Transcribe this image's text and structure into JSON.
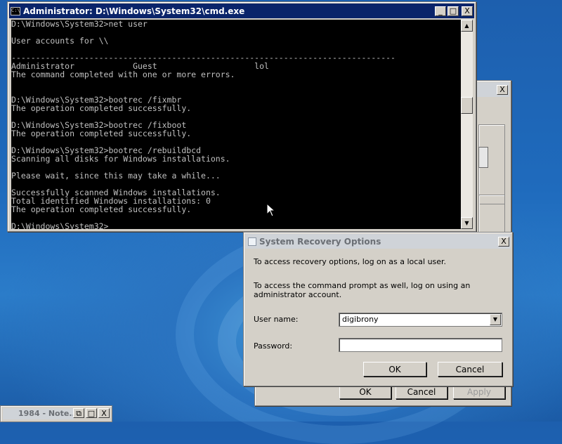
{
  "cmd_window": {
    "title": "Administrator: D:\\Windows\\System32\\cmd.exe",
    "icon_text": "C:\\",
    "lines": [
      "D:\\Windows\\System32>net user",
      "",
      "User accounts for \\\\",
      "",
      "-------------------------------------------------------------------------------",
      "Administrator            Guest                    lol",
      "The command completed with one or more errors.",
      "",
      "",
      "D:\\Windows\\System32>bootrec /fixmbr",
      "The operation completed successfully.",
      "",
      "D:\\Windows\\System32>bootrec /fixboot",
      "The operation completed successfully.",
      "",
      "D:\\Windows\\System32>bootrec /rebuildbcd",
      "Scanning all disks for Windows installations.",
      "",
      "Please wait, since this may take a while...",
      "",
      "Successfully scanned Windows installations.",
      "Total identified Windows installations: 0",
      "The operation completed successfully.",
      "",
      "D:\\Windows\\System32>"
    ],
    "minimize_glyph": "_",
    "maximize_glyph": "□",
    "close_glyph": "X"
  },
  "background_window": {
    "close_glyph": "X",
    "ok_label": "OK",
    "cancel_label": "Cancel",
    "apply_label": "Apply"
  },
  "recovery_dialog": {
    "title": "System Recovery Options",
    "close_glyph": "X",
    "text1": "To access recovery options, log on as a local user.",
    "text2": "To access the command prompt as well, log on using an administrator account.",
    "username_label": "User name:",
    "username_value": "digibrony",
    "password_label": "Password:",
    "password_value": "",
    "ok_label": "OK",
    "cancel_label": "Cancel"
  },
  "minimized_window": {
    "title": "1984 - Note...",
    "restore_glyph": "⧉",
    "maximize_glyph": "□",
    "close_glyph": "X"
  },
  "colors": {
    "title_active": "#0a246a",
    "console_bg": "#000000",
    "console_text": "#c0c0c0"
  }
}
